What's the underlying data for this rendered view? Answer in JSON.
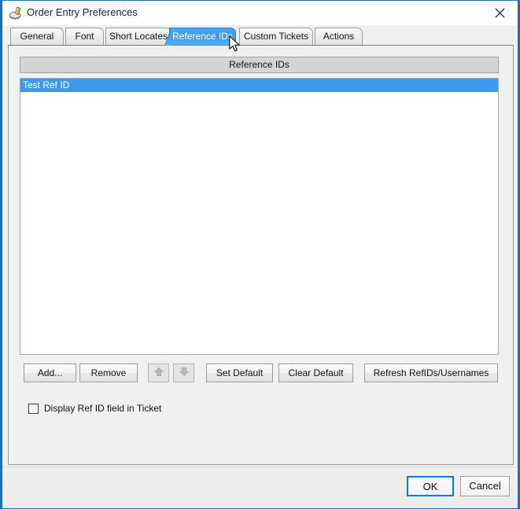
{
  "window": {
    "title": "Order Entry Preferences",
    "icon": "plug-icon",
    "close_icon": "close-icon",
    "border_color": "#1a6fb5"
  },
  "tabs": {
    "items": [
      {
        "label": "General",
        "selected": false
      },
      {
        "label": "Font",
        "selected": false
      },
      {
        "label": "Short Locates",
        "selected": false
      },
      {
        "label": "Reference IDs",
        "selected": true
      },
      {
        "label": "Custom Tickets",
        "selected": false
      },
      {
        "label": "Actions",
        "selected": false
      }
    ],
    "selected_label": "Reference IDs",
    "selected_color": "#3d9cf0"
  },
  "panel": {
    "group_header": "Reference IDs",
    "list": {
      "items": [
        {
          "label": "Test Ref ID",
          "selected": true
        }
      ],
      "selection_color": "#3b99f0"
    },
    "buttons": {
      "add": "Add...",
      "remove": "Remove",
      "move_up": "move-up-icon",
      "move_down": "move-down-icon",
      "set_default": "Set Default",
      "clear_default": "Clear Default",
      "refresh": "Refresh RefIDs/Usernames"
    },
    "checkbox": {
      "label": "Display Ref ID field in Ticket",
      "checked": false
    }
  },
  "footer": {
    "ok": "OK",
    "cancel": "Cancel",
    "focus_color": "#0a7ad6"
  },
  "cursor": {
    "type": "arrow-pointer"
  }
}
